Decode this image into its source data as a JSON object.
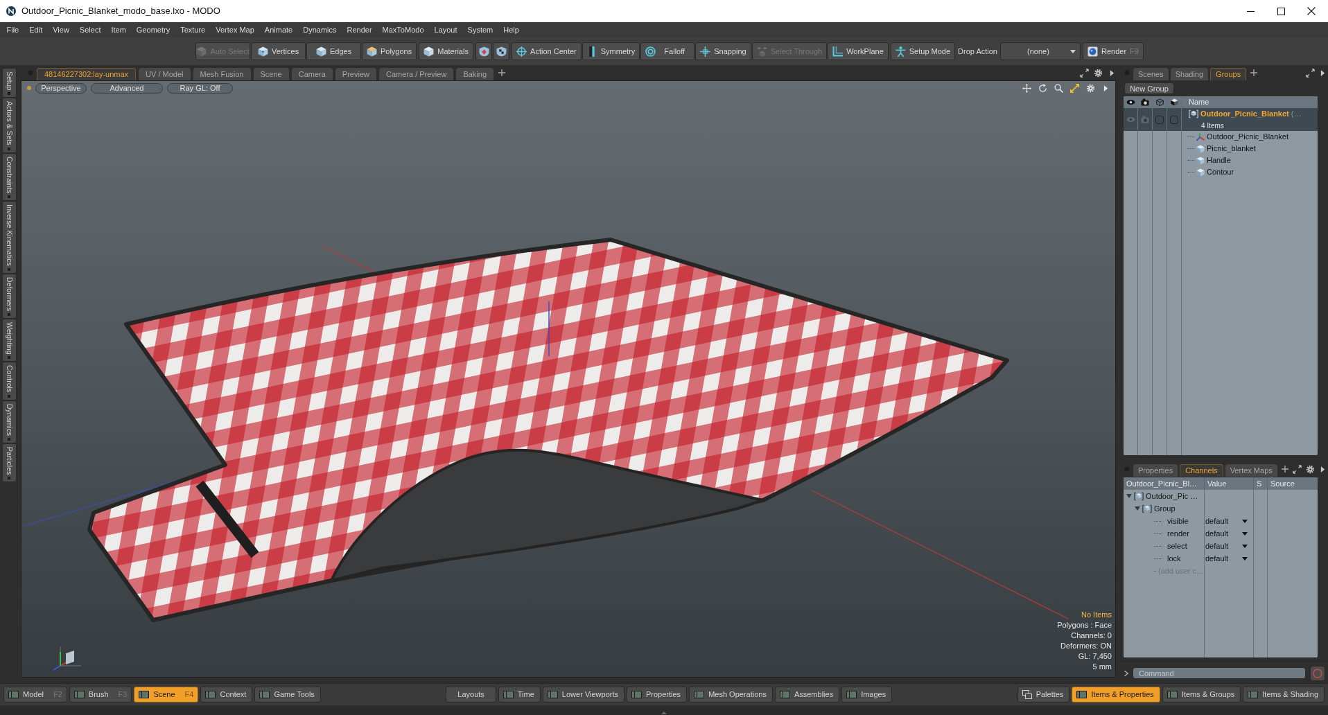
{
  "window": {
    "title": "Outdoor_Picnic_Blanket_modo_base.lxo - MODO"
  },
  "menu": [
    "File",
    "Edit",
    "View",
    "Select",
    "Item",
    "Geometry",
    "Texture",
    "Vertex Map",
    "Animate",
    "Dynamics",
    "Render",
    "MaxToModo",
    "Layout",
    "System",
    "Help"
  ],
  "toolbar_groups": [
    {
      "items": [
        {
          "kind": "mode",
          "label": "Auto Select",
          "disabled": true
        },
        {
          "kind": "mode",
          "label": "Vertices",
          "disabled": false
        },
        {
          "kind": "mode",
          "label": "Edges",
          "disabled": false
        },
        {
          "kind": "mode",
          "label": "Polygons",
          "disabled": false
        }
      ]
    },
    {
      "items": [
        {
          "kind": "mode",
          "label": "Materials",
          "disabled": false
        }
      ]
    },
    {
      "items": [
        {
          "kind": "icon",
          "disabled": false
        },
        {
          "kind": "icon",
          "disabled": false
        }
      ]
    },
    {
      "items": [
        {
          "kind": "tool",
          "label": "Action Center",
          "disabled": false
        },
        {
          "kind": "tool",
          "label": "Symmetry",
          "disabled": false
        },
        {
          "kind": "tool",
          "label": "Falloff",
          "disabled": false
        },
        {
          "kind": "tool",
          "label": "Snapping",
          "disabled": false
        },
        {
          "kind": "tool",
          "label": "Select Through",
          "disabled": true
        },
        {
          "kind": "tool",
          "label": "WorkPlane",
          "disabled": false
        }
      ]
    },
    {
      "items": [
        {
          "kind": "tool",
          "label": "Setup Mode",
          "disabled": false
        }
      ]
    },
    {
      "items": [
        {
          "kind": "label",
          "label": "Drop Action"
        }
      ]
    },
    {
      "items": [
        {
          "kind": "dropdown",
          "value": "(none)"
        }
      ]
    },
    {
      "items": [
        {
          "kind": "render",
          "label": "Render",
          "shortcut": "F9",
          "disabled": false
        }
      ]
    }
  ],
  "side_tabs": [
    "Setup",
    "Actors & Sets",
    "Constraints",
    "Inverse Kinematics",
    "Deformers",
    "Weighting",
    "Controls",
    "Dynamics",
    "Particles"
  ],
  "viewport_tabs": [
    {
      "label": "48146227302:lay-unmax",
      "selected": true
    },
    {
      "label": "UV / Model",
      "selected": false
    },
    {
      "label": "Mesh Fusion",
      "selected": false
    },
    {
      "label": "Scene",
      "selected": false
    },
    {
      "label": "Camera",
      "selected": false
    },
    {
      "label": "Preview",
      "selected": false
    },
    {
      "label": "Camera / Preview",
      "selected": false
    },
    {
      "label": "Baking",
      "selected": false
    }
  ],
  "viewport": {
    "header_buttons": [
      "Perspective",
      "Advanced",
      "Ray GL: Off"
    ],
    "info": [
      {
        "text": "No Items",
        "kind": "highlight"
      },
      {
        "text": "Polygons : Face",
        "kind": "plain"
      },
      {
        "text": "Channels: 0",
        "kind": "plain"
      },
      {
        "text": "Deformers: ON",
        "kind": "plain"
      },
      {
        "text": "GL: 7,450",
        "kind": "plain"
      },
      {
        "text": "5 mm",
        "kind": "plain"
      }
    ]
  },
  "groups_panel": {
    "tabs": [
      {
        "label": "Scenes",
        "selected": false
      },
      {
        "label": "Shading",
        "selected": false
      },
      {
        "label": "Groups",
        "selected": true
      }
    ],
    "new_group_button": "New Group",
    "name_column": "Name",
    "group": {
      "name": "Outdoor_Picnic_Blanket",
      "suffix": "(…",
      "count": "4 Items",
      "selected": true,
      "items": [
        {
          "name": "Outdoor_Picnic_Blanket",
          "kind": "locator"
        },
        {
          "name": "Picnic_blanket",
          "kind": "mesh"
        },
        {
          "name": "Handle",
          "kind": "mesh"
        },
        {
          "name": "Contour",
          "kind": "mesh"
        }
      ]
    }
  },
  "channels_panel": {
    "tabs": [
      {
        "label": "Properties",
        "selected": false
      },
      {
        "label": "Channels",
        "selected": true
      },
      {
        "label": "Vertex Maps",
        "selected": false
      }
    ],
    "columns": [
      "Outdoor_Picnic_Bl…",
      "Value",
      "S",
      "Source"
    ],
    "tree": [
      {
        "label": "Outdoor_Pic …",
        "kind": "item",
        "expanded": true,
        "children": [
          {
            "label": "Group",
            "kind": "item",
            "expanded": true,
            "children": [
              {
                "label": "visible",
                "kind": "channel",
                "value": "default"
              },
              {
                "label": "render",
                "kind": "channel",
                "value": "default"
              },
              {
                "label": "select",
                "kind": "channel",
                "value": "default"
              },
              {
                "label": "lock",
                "kind": "channel",
                "value": "default"
              },
              {
                "label": "(add user c…",
                "kind": "placeholder"
              }
            ]
          }
        ]
      }
    ]
  },
  "command": {
    "placeholder": "Command"
  },
  "bottom_bar": {
    "left": [
      {
        "kind": "layout",
        "label": "Model",
        "shortcut": "F2",
        "selected": false
      },
      {
        "kind": "layout",
        "label": "Brush",
        "shortcut": "F3",
        "selected": false
      },
      {
        "kind": "layout",
        "label": "Scene",
        "shortcut": "F4",
        "selected": true
      },
      {
        "kind": "layout",
        "label": "Context",
        "selected": false
      },
      {
        "kind": "layout",
        "label": "Game Tools",
        "selected": false
      }
    ],
    "center": [
      {
        "kind": "menu",
        "label": "Layouts",
        "selected": false
      },
      {
        "kind": "layout",
        "label": "Time",
        "selected": false
      },
      {
        "kind": "layout",
        "label": "Lower Viewports",
        "selected": false
      },
      {
        "kind": "layout",
        "label": "Properties",
        "selected": false
      },
      {
        "kind": "layout",
        "label": "Mesh Operations",
        "selected": false
      },
      {
        "kind": "layout",
        "label": "Assemblies",
        "selected": false
      },
      {
        "kind": "layout",
        "label": "Images",
        "selected": false
      }
    ],
    "right": [
      {
        "kind": "palette",
        "label": "Palettes",
        "selected": false
      },
      {
        "kind": "layout",
        "label": "Items & Properties",
        "selected": true
      },
      {
        "kind": "layout",
        "label": "Items & Groups",
        "selected": false
      },
      {
        "kind": "layout",
        "label": "Items & Shading",
        "selected": false
      }
    ]
  }
}
